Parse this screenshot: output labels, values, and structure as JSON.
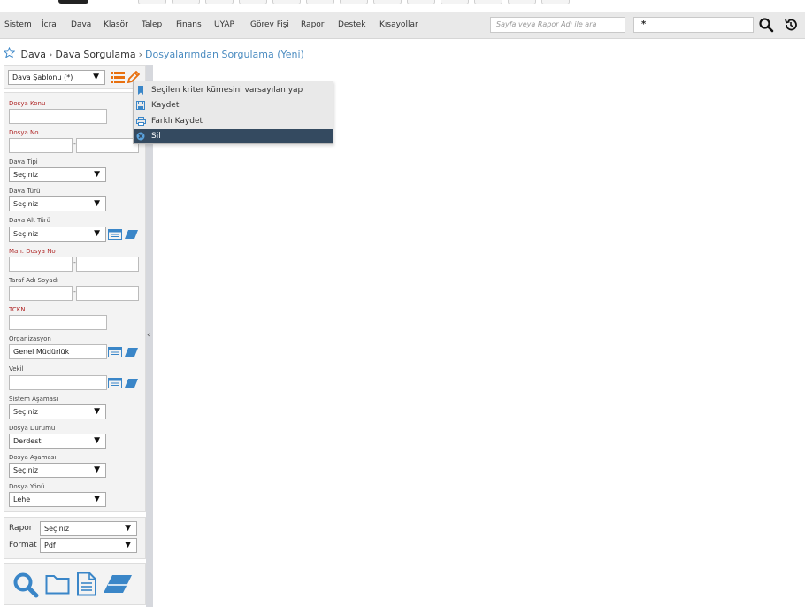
{
  "menu": {
    "items": [
      "Sistem",
      "İcra",
      "Dava",
      "Klasör",
      "Talep",
      "Finans",
      "UYAP",
      "Görev Fişi",
      "Rapor",
      "Destek",
      "Kısayollar"
    ]
  },
  "search": {
    "placeholder": "Sayfa veya Rapor Adı ile ara",
    "code_value": "*"
  },
  "breadcrumb": {
    "items": [
      "Dava",
      "Dava Sorgulama",
      "Dosyalarımdan Sorgulama (Yeni)"
    ]
  },
  "template": {
    "value": "Dava Şablonu (*)"
  },
  "template_menu": {
    "items": [
      "Seçilen kriter kümesini varsayılan yap",
      "Kaydet",
      "Farklı Kaydet",
      "Sil"
    ]
  },
  "form": {
    "dosya_konu_label": "Dosya Konu",
    "dosya_no_label": "Dosya No",
    "dava_tipi_label": "Dava Tipi",
    "dava_tipi_value": "Seçiniz",
    "dava_turu_label": "Dava Türü",
    "dava_turu_value": "Seçiniz",
    "dava_alt_turu_label": "Dava Alt Türü",
    "dava_alt_turu_value": "Seçiniz",
    "mah_dosya_no_label": "Mah. Dosya No",
    "taraf_label": "Taraf Adı Soyadı",
    "tckn_label": "TCKN",
    "organizasyon_label": "Organizasyon",
    "organizasyon_value": "Genel Müdürlük",
    "vekil_label": "Vekil",
    "sistem_asamasi_label": "Sistem Aşaması",
    "sistem_asamasi_value": "Seçiniz",
    "dosya_durumu_label": "Dosya Durumu",
    "dosya_durumu_value": "Derdest",
    "dosya_asamasi_label": "Dosya Aşaması",
    "dosya_asamasi_value": "Seçiniz",
    "dosya_yonu_label": "Dosya Yönü",
    "dosya_yonu_value": "Lehe",
    "dash": "-"
  },
  "report": {
    "rapor_label": "Rapor",
    "rapor_value": "Seçiniz",
    "format_label": "Format",
    "format_value": "Pdf"
  },
  "colors": {
    "accent_blue": "#3a86c8",
    "required_red": "#b02828",
    "menu_active": "#344a60",
    "orange": "#e8700f"
  },
  "icons": [
    "star-icon",
    "search-icon",
    "history-icon",
    "list-icon",
    "pencil-icon",
    "bookmark-icon",
    "save-icon",
    "print-icon",
    "delete-icon",
    "table-icon",
    "eraser-icon",
    "folder-icon",
    "document-icon",
    "chevron-left-icon"
  ]
}
